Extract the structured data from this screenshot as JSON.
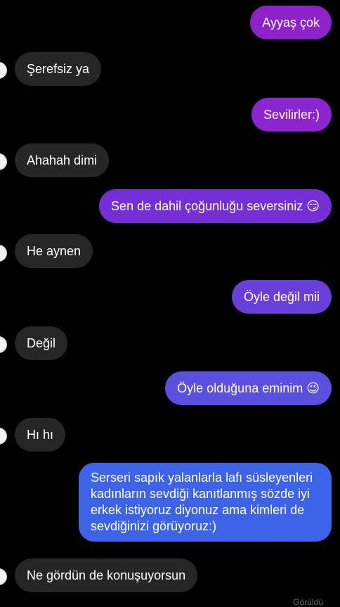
{
  "messages": [
    {
      "dir": "out",
      "text": "Ayyaş çok",
      "color": "#8e22c9"
    },
    {
      "dir": "in",
      "text": "Şerefsiz ya"
    },
    {
      "dir": "out",
      "text": "Sevilirler:)",
      "color": "#8a25d0"
    },
    {
      "dir": "in",
      "text": "Ahahah dimi"
    },
    {
      "dir": "out",
      "text": "Sen de dahil çoğunluğu seversiniz 😏",
      "color": "#7430d6"
    },
    {
      "dir": "in",
      "text": "He aynen"
    },
    {
      "dir": "out",
      "text": "Öyle değil mii",
      "color": "#6a3ed8"
    },
    {
      "dir": "in",
      "text": "Değil"
    },
    {
      "dir": "out",
      "text": "Öyle olduğuna eminim 😉",
      "color": "#5a4fdf"
    },
    {
      "dir": "in",
      "text": "Hı hı"
    },
    {
      "dir": "out",
      "text": "Serseri sapık yalanlarla lafı süsleyenleri kadınların sevdiği kanıtlanmış sözde iyi erkek istiyoruz diyonuz ama kimleri de sevdiğinizi görüyoruz:)",
      "color": "#3d63e6"
    },
    {
      "dir": "in",
      "text": "Ne gördün de konuşuyorsun"
    }
  ],
  "seen_label": "Görüldü"
}
